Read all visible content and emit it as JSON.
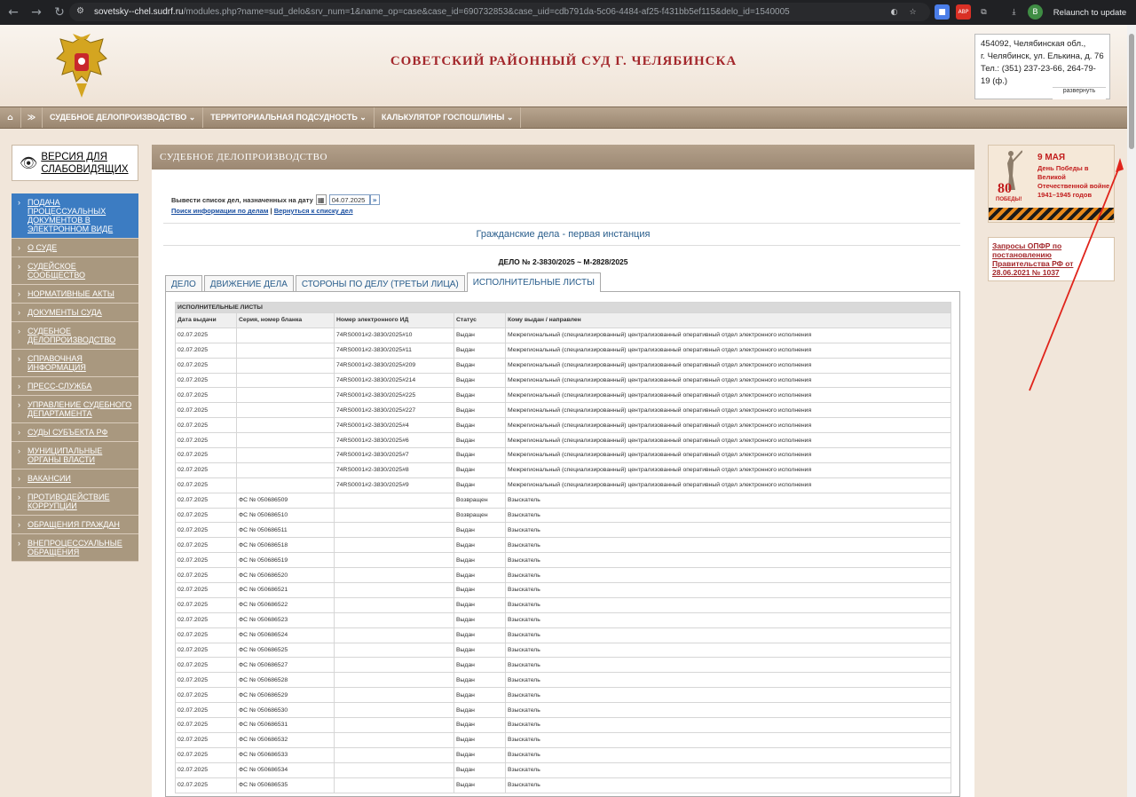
{
  "browser": {
    "url_host": "sovetsky--chel.sudrf.ru",
    "url_rest": "/modules.php?name=sud_delo&srv_num=1&name_op=case&case_id=690732853&case_uid=cdb791da-5c06-4484-af25-f431bb5ef115&delo_id=1540005",
    "relaunch_label": "Relaunch to update"
  },
  "header": {
    "court_title": "СОВЕТСКИЙ РАЙОННЫЙ СУД Г. ЧЕЛЯБИНСКА",
    "address_lines": [
      "454092, Челябинская обл.,",
      "г. Челябинск, ул. Елькина, д. 76",
      "Тел.: (351) 237-23-66, 264-79-",
      "19 (ф.)"
    ],
    "expand_label": "развернуть"
  },
  "nav": {
    "items": [
      "СУДЕБНОЕ ДЕЛОПРОИЗВОДСТВО ⌄",
      "ТЕРРИТОРИАЛЬНАЯ ПОДСУДНОСТЬ ⌄",
      "КАЛЬКУЛЯТОР ГОСПОШЛИНЫ ⌄"
    ]
  },
  "sidebar": {
    "vision_label": "ВЕРСИЯ ДЛЯ СЛАБОВИДЯЩИХ",
    "items": [
      "ПОДАЧА ПРОЦЕССУАЛЬНЫХ ДОКУМЕНТОВ В ЭЛЕКТРОННОМ ВИДЕ",
      "О СУДЕ",
      "СУДЕЙСКОЕ СООБЩЕСТВО",
      "НОРМАТИВНЫЕ АКТЫ",
      "ДОКУМЕНТЫ СУДА",
      "СУДЕБНОЕ ДЕЛОПРОИЗВОДСТВО",
      "СПРАВОЧНАЯ ИНФОРМАЦИЯ",
      "ПРЕСС-СЛУЖБА",
      "УПРАВЛЕНИЕ СУДЕБНОГО ДЕПАРТАМЕНТА",
      "СУДЫ СУБЪЕКТА РФ",
      "МУНИЦИПАЛЬНЫЕ ОРГАНЫ ВЛАСТИ",
      "ВАКАНСИИ",
      "ПРОТИВОДЕЙСТВИЕ КОРРУПЦИИ",
      "ОБРАЩЕНИЯ ГРАЖДАН",
      "ВНЕПРОЦЕССУАЛЬНЫЕ ОБРАЩЕНИЯ"
    ]
  },
  "main": {
    "section_title": "СУДЕБНОЕ ДЕЛОПРОИЗВОДСТВО",
    "date_prompt": "Вывести список дел, назначенных на дату",
    "date_value": "04.07.2025",
    "link_search": "Поиск информации по делам",
    "link_separator": "|",
    "link_back": "Вернуться к списку дел",
    "case_category": "Гражданские дела - первая инстанция",
    "case_number": "ДЕЛО № 2-3830/2025 ~ М-2828/2025",
    "tabs": [
      "ДЕЛО",
      "ДВИЖЕНИЕ ДЕЛА",
      "СТОРОНЫ ПО ДЕЛУ (ТРЕТЬИ ЛИЦА)",
      "ИСПОЛНИТЕЛЬНЫЕ ЛИСТЫ"
    ],
    "table": {
      "caption": "ИСПОЛНИТЕЛЬНЫЕ ЛИСТЫ",
      "columns": [
        "Дата выдачи",
        "Серия, номер бланка",
        "Номер электронного ИД",
        "Статус",
        "Кому выдан / направлен"
      ],
      "rows": [
        [
          "02.07.2025",
          "",
          "74RS0001#2-3830/2025#10",
          "Выдан",
          "Межрегиональный (специализированный) централизованный оперативный отдел электронного исполнения"
        ],
        [
          "02.07.2025",
          "",
          "74RS0001#2-3830/2025#11",
          "Выдан",
          "Межрегиональный (специализированный) централизованный оперативный отдел электронного исполнения"
        ],
        [
          "02.07.2025",
          "",
          "74RS0001#2-3830/2025#209",
          "Выдан",
          "Межрегиональный (специализированный) централизованный оперативный отдел электронного исполнения"
        ],
        [
          "02.07.2025",
          "",
          "74RS0001#2-3830/2025#214",
          "Выдан",
          "Межрегиональный (специализированный) централизованный оперативный отдел электронного исполнения"
        ],
        [
          "02.07.2025",
          "",
          "74RS0001#2-3830/2025#225",
          "Выдан",
          "Межрегиональный (специализированный) централизованный оперативный отдел электронного исполнения"
        ],
        [
          "02.07.2025",
          "",
          "74RS0001#2-3830/2025#227",
          "Выдан",
          "Межрегиональный (специализированный) централизованный оперативный отдел электронного исполнения"
        ],
        [
          "02.07.2025",
          "",
          "74RS0001#2-3830/2025#4",
          "Выдан",
          "Межрегиональный (специализированный) централизованный оперативный отдел электронного исполнения"
        ],
        [
          "02.07.2025",
          "",
          "74RS0001#2-3830/2025#6",
          "Выдан",
          "Межрегиональный (специализированный) централизованный оперативный отдел электронного исполнения"
        ],
        [
          "02.07.2025",
          "",
          "74RS0001#2-3830/2025#7",
          "Выдан",
          "Межрегиональный (специализированный) централизованный оперативный отдел электронного исполнения"
        ],
        [
          "02.07.2025",
          "",
          "74RS0001#2-3830/2025#8",
          "Выдан",
          "Межрегиональный (специализированный) централизованный оперативный отдел электронного исполнения"
        ],
        [
          "02.07.2025",
          "",
          "74RS0001#2-3830/2025#9",
          "Выдан",
          "Межрегиональный (специализированный) централизованный оперативный отдел электронного исполнения"
        ],
        [
          "02.07.2025",
          "ФС № 050686509",
          "",
          "Возвращен",
          "Взыскатель"
        ],
        [
          "02.07.2025",
          "ФС № 050686510",
          "",
          "Возвращен",
          "Взыскатель"
        ],
        [
          "02.07.2025",
          "ФС № 050686511",
          "",
          "Выдан",
          "Взыскатель"
        ],
        [
          "02.07.2025",
          "ФС № 050686518",
          "",
          "Выдан",
          "Взыскатель"
        ],
        [
          "02.07.2025",
          "ФС № 050686519",
          "",
          "Выдан",
          "Взыскатель"
        ],
        [
          "02.07.2025",
          "ФС № 050686520",
          "",
          "Выдан",
          "Взыскатель"
        ],
        [
          "02.07.2025",
          "ФС № 050686521",
          "",
          "Выдан",
          "Взыскатель"
        ],
        [
          "02.07.2025",
          "ФС № 050686522",
          "",
          "Выдан",
          "Взыскатель"
        ],
        [
          "02.07.2025",
          "ФС № 050686523",
          "",
          "Выдан",
          "Взыскатель"
        ],
        [
          "02.07.2025",
          "ФС № 050686524",
          "",
          "Выдан",
          "Взыскатель"
        ],
        [
          "02.07.2025",
          "ФС № 050686525",
          "",
          "Выдан",
          "Взыскатель"
        ],
        [
          "02.07.2025",
          "ФС № 050686527",
          "",
          "Выдан",
          "Взыскатель"
        ],
        [
          "02.07.2025",
          "ФС № 050686528",
          "",
          "Выдан",
          "Взыскатель"
        ],
        [
          "02.07.2025",
          "ФС № 050686529",
          "",
          "Выдан",
          "Взыскатель"
        ],
        [
          "02.07.2025",
          "ФС № 050686530",
          "",
          "Выдан",
          "Взыскатель"
        ],
        [
          "02.07.2025",
          "ФС № 050686531",
          "",
          "Выдан",
          "Взыскатель"
        ],
        [
          "02.07.2025",
          "ФС № 050686532",
          "",
          "Выдан",
          "Взыскатель"
        ],
        [
          "02.07.2025",
          "ФС № 050686533",
          "",
          "Выдан",
          "Взыскатель"
        ],
        [
          "02.07.2025",
          "ФС № 050686534",
          "",
          "Выдан",
          "Взыскатель"
        ],
        [
          "02.07.2025",
          "ФС № 050686535",
          "",
          "Выдан",
          "Взыскатель"
        ]
      ]
    }
  },
  "right": {
    "banner": {
      "line1": "9 МАЯ",
      "line2": "День Победы в Великой Отечественной войне 1941–1945 годов",
      "big": "80",
      "small": "ПОБЕДЫ!"
    },
    "opfr_link": "Запросы ОПФР по постановлению Правительства РФ от 28.06.2021 № 1037"
  },
  "colors": {
    "accent_red": "#a3272b",
    "nav_brown": "#9a8670",
    "active_blue": "#3c7cc2",
    "link_blue": "#1a4fa0",
    "annotation_red": "#e0241b"
  },
  "icons": {
    "home": "home-icon",
    "eye": "eye-icon",
    "calendar": "calendar-icon"
  }
}
